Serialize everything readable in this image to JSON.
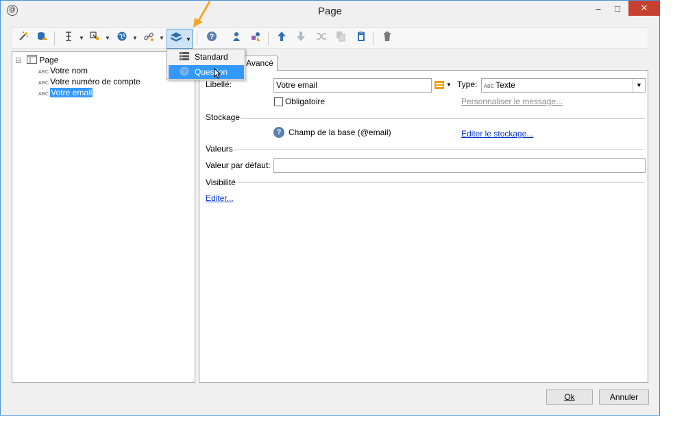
{
  "window": {
    "title": "Page",
    "minimize": "–",
    "maximize": "□",
    "close": "✕",
    "app_icon": "@"
  },
  "toolbar": {
    "icons": [
      "wand-icon",
      "database-icon",
      "text-cursor-icon",
      "form-field-icon",
      "globe-icon",
      "link-icon",
      "container-icon",
      "help-icon",
      "user-icon",
      "shapes-icon",
      "arrow-up-icon",
      "arrow-down-icon",
      "shuffle-icon",
      "copy-icon",
      "paste-icon",
      "trash-icon"
    ]
  },
  "dropdown_menu": {
    "items": [
      {
        "label": "Standard",
        "icon": "list-icon"
      },
      {
        "label": "Question",
        "icon": "question-icon"
      }
    ]
  },
  "tree": {
    "root": "Page",
    "type_prefix": "ABC",
    "children": [
      "Votre nom",
      "Votre numéro de compte",
      "Votre email"
    ]
  },
  "tabs": {
    "advanced": "Avancé"
  },
  "form": {
    "libelle_label": "Libellé:",
    "libelle_value": "Votre email",
    "type_label": "Type:",
    "type_prefix": "ABC",
    "type_value": "Texte",
    "obligatoire_label": "Obligatoire",
    "personnaliser_link": "Personnaliser le message...",
    "stockage_title": "Stockage",
    "champ_text": "Champ de la base (@email)",
    "editer_stockage_link": "Editer le stockage...",
    "valeurs_title": "Valeurs",
    "defaut_label": "Valeur par défaut:",
    "defaut_value": "",
    "visibilite_title": "Visibilité",
    "editer_link": "Editer..."
  },
  "buttons": {
    "ok": "Ok",
    "annuler": "Annuler"
  },
  "colors": {
    "accent": "#3399ff",
    "arrow": "#f5a623",
    "close": "#c7402f"
  }
}
